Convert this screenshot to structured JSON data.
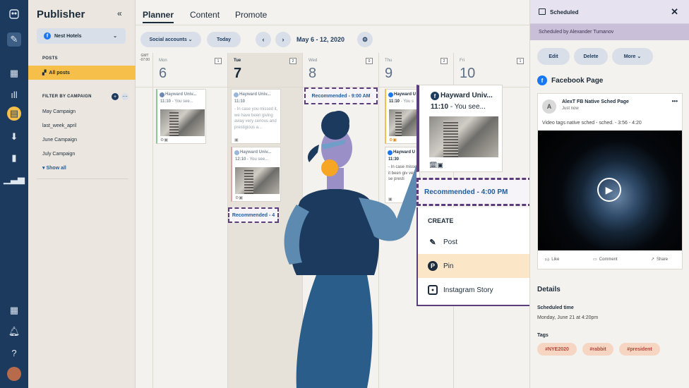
{
  "sidebar": {
    "title": "Publisher",
    "collapse": "«",
    "account": "Nest Hotels",
    "posts_heading": "POSTS",
    "all_posts": "All posts",
    "filter_heading": "FILTER BY CAMPAIGN",
    "campaigns": [
      "May Campaign",
      "last_week_april",
      "June Campaign",
      "July Campaign"
    ],
    "show_all": "Show all"
  },
  "tabs": [
    "Planner",
    "Content",
    "Promote"
  ],
  "toolbar": {
    "social_accounts": "Social accounts",
    "today": "Today",
    "prev": "‹",
    "next": "›",
    "date_range": "May 6 - 12, 2020"
  },
  "calendar": {
    "gmt": "GMT -07:00",
    "days": [
      {
        "name": "Mon",
        "num": "6",
        "badge": "1"
      },
      {
        "name": "Tue",
        "num": "7",
        "badge": "2"
      },
      {
        "name": "Wed",
        "num": "8",
        "badge": "0"
      },
      {
        "name": "Thu",
        "num": "9",
        "badge": "2"
      },
      {
        "name": "Fri",
        "num": "10",
        "badge": "1"
      }
    ],
    "cards": [
      {
        "name": "Hayward Univ...",
        "time": "11:10",
        "text": "- You see..."
      },
      {
        "name": "Hayward Univ...",
        "time": "11:10",
        "text": "- In case you missed it, we have been giving away very serious and prestigious a..."
      },
      {
        "name": "Hayward Univ...",
        "time": "12:10",
        "text": "- You see..."
      },
      {
        "name": "Hayward U",
        "time": "11:10",
        "text": "- You s"
      },
      {
        "name": "Hayward U",
        "time": "11:30",
        "text": "- In case missed it been giv very se presti"
      }
    ],
    "rec_wed": "Recommended - 9:00 AM",
    "rec_tue": "Recommended - 4"
  },
  "popup": {
    "name": "Hayward Univ...",
    "time": "11:10",
    "text": "- You see...",
    "recommended": "Recommended - 4:00 PM",
    "create_heading": "CREATE",
    "items": [
      "Post",
      "Pin",
      "Instagram Story"
    ]
  },
  "right_panel": {
    "title": "Scheduled",
    "scheduled_by": "Scheduled by Alexander Tumanov",
    "edit": "Edit",
    "delete": "Delete",
    "more": "More",
    "network": "Facebook Page",
    "post_page": "AlexT FB Native Sched Page",
    "post_time": "Just now",
    "avatar_letter": "A",
    "caption": "Video tags native sched - sched. - 3:56 - 4:20",
    "like": "Like",
    "comment": "Comment",
    "share": "Share",
    "details": "Details",
    "scheduled_time_label": "Scheduled time",
    "scheduled_time": "Monday, June 21 at 4:20pm",
    "tags_label": "Tags",
    "tags": [
      "#NYE2020",
      "#rabbit",
      "#president"
    ]
  },
  "colors": {
    "rail": "#1c3a5e",
    "accent_yellow": "#f6bf4a",
    "recommended_border": "#5a3d7a",
    "tag_bg": "#f7d5c3"
  }
}
